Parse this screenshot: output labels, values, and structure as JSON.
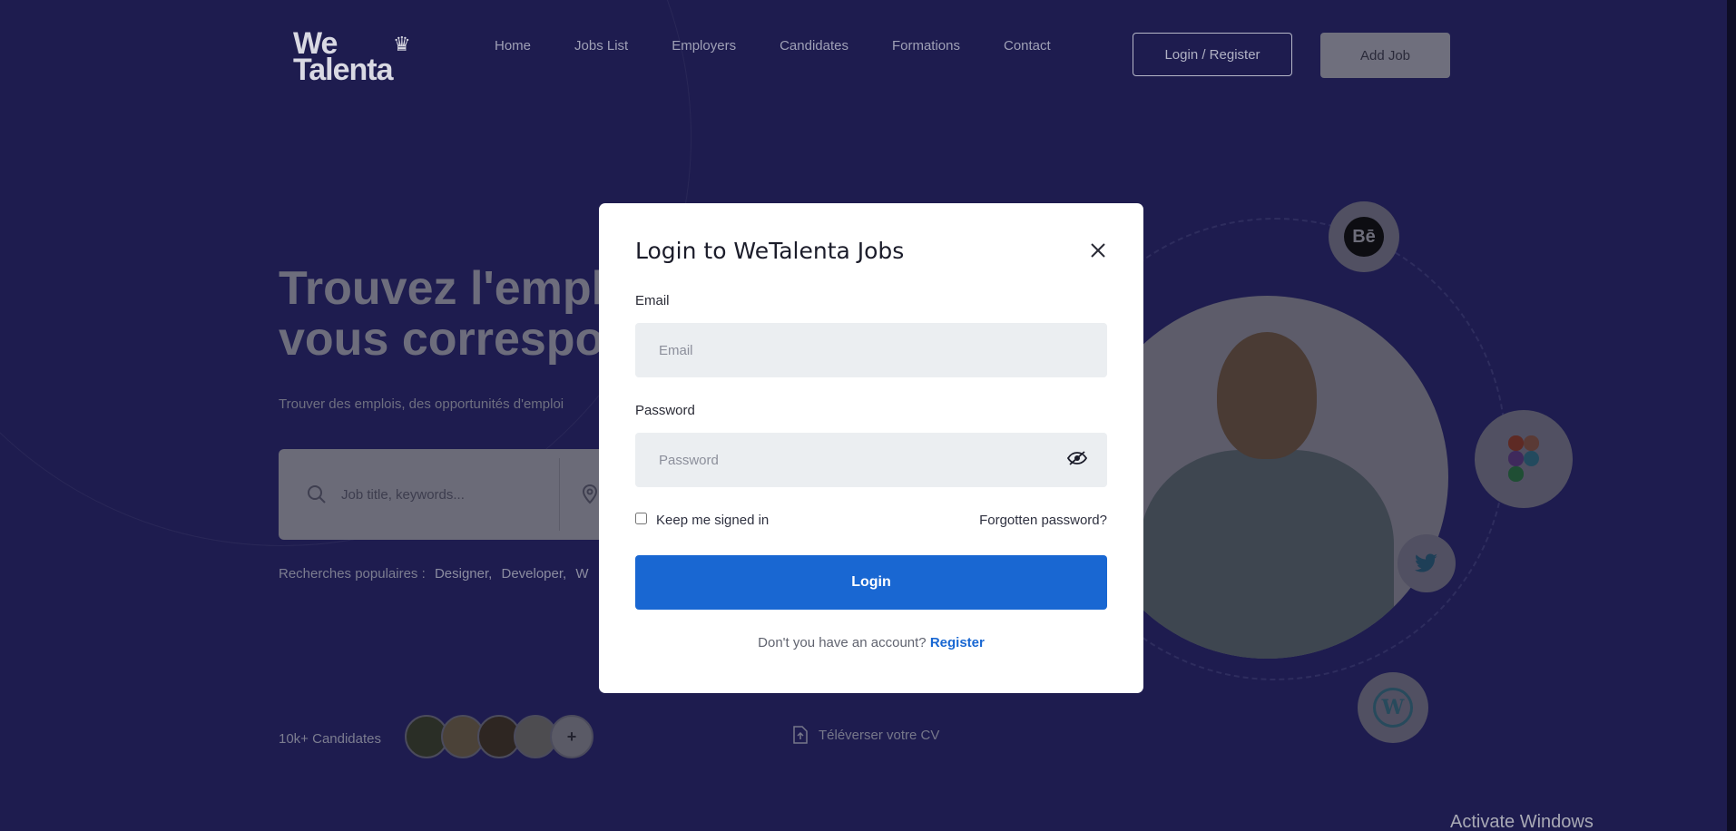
{
  "header": {
    "logo_line1": "We",
    "logo_line2": "Talenta",
    "nav": [
      "Home",
      "Jobs List",
      "Employers",
      "Candidates",
      "Formations",
      "Contact"
    ],
    "login_register": "Login / Register",
    "add_job": "Add Job"
  },
  "hero": {
    "title": "Trouvez l'empl\nvous correspo",
    "subtitle": "Trouver des emplois, des opportunités d'emploi",
    "search_placeholder": "Job title, keywords...",
    "popular_label": "Recherches populaires :",
    "popular_items": [
      "Designer,",
      "Developer,",
      "W"
    ],
    "candidates": "10k+ Candidates",
    "upload_cv": "Téléverser votre CV"
  },
  "modal": {
    "title": "Login to WeTalenta Jobs",
    "email_label": "Email",
    "email_placeholder": "Email",
    "password_label": "Password",
    "password_placeholder": "Password",
    "keep_signed": "Keep me signed in",
    "forgot": "Forgotten password?",
    "login_button": "Login",
    "no_account": "Don't you have an account?",
    "register": "Register"
  },
  "system": {
    "watermark": "Activate Windows"
  },
  "colors": {
    "primary": "#1967d2",
    "overlay_bg": "#1e1c4f"
  }
}
